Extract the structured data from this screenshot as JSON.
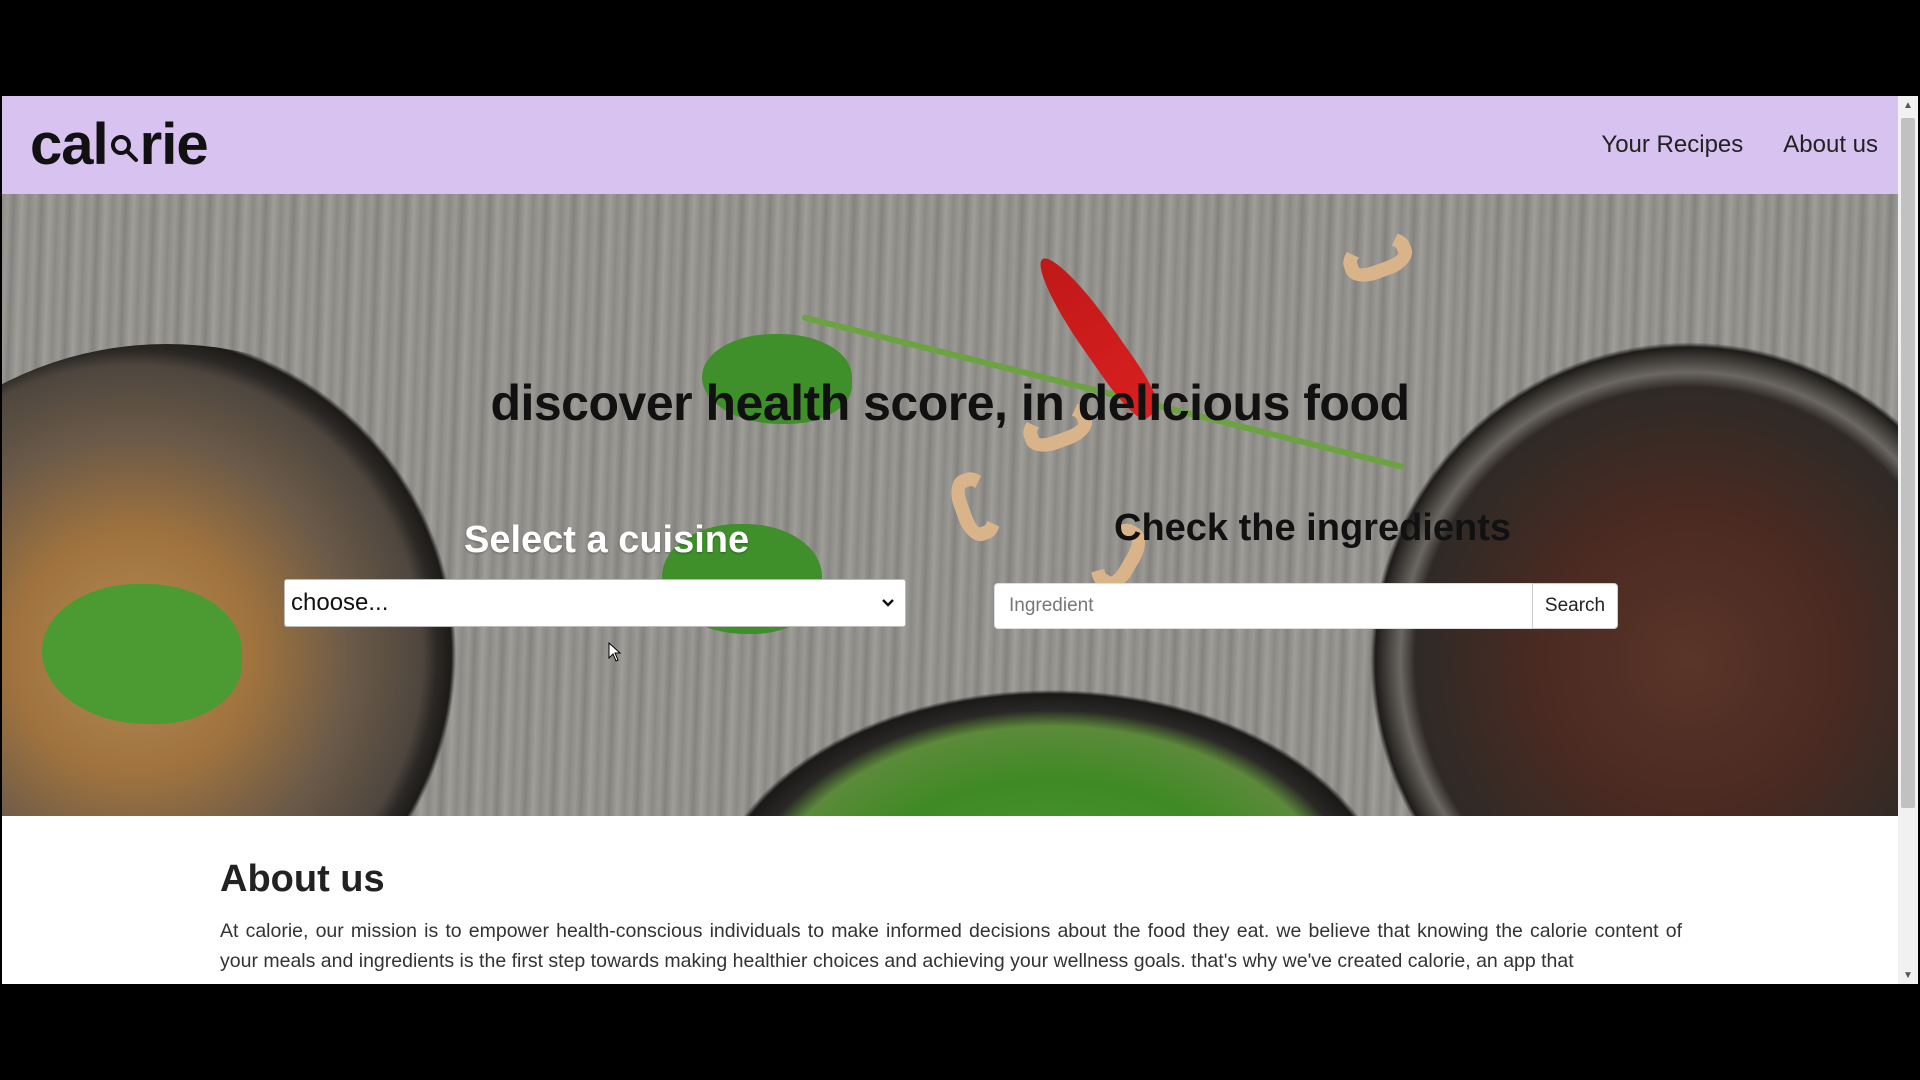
{
  "navbar": {
    "logo_left": "cal",
    "logo_right": "rie",
    "logo_icon": "magnifier-icon",
    "links": [
      "Your Recipes",
      "About us"
    ],
    "background": "#d7c2f0"
  },
  "hero": {
    "title": "discover health score, in delicious food",
    "cuisine_label": "Select a cuisine",
    "cuisine_select_value": "choose...",
    "ingredients_label": "Check the ingredients",
    "ingredient_placeholder": "Ingredient",
    "search_label": "Search"
  },
  "about": {
    "title": "About us",
    "text": "At calorie, our mission is to empower health-conscious individuals to make informed decisions about the food they eat. we believe that knowing the calorie content of your meals and ingredients is the first step towards making healthier choices and achieving your wellness goals. that's why we've created calorie, an app that"
  },
  "colors": {
    "accent": "#d7c2f0",
    "text_dark": "#111111"
  }
}
